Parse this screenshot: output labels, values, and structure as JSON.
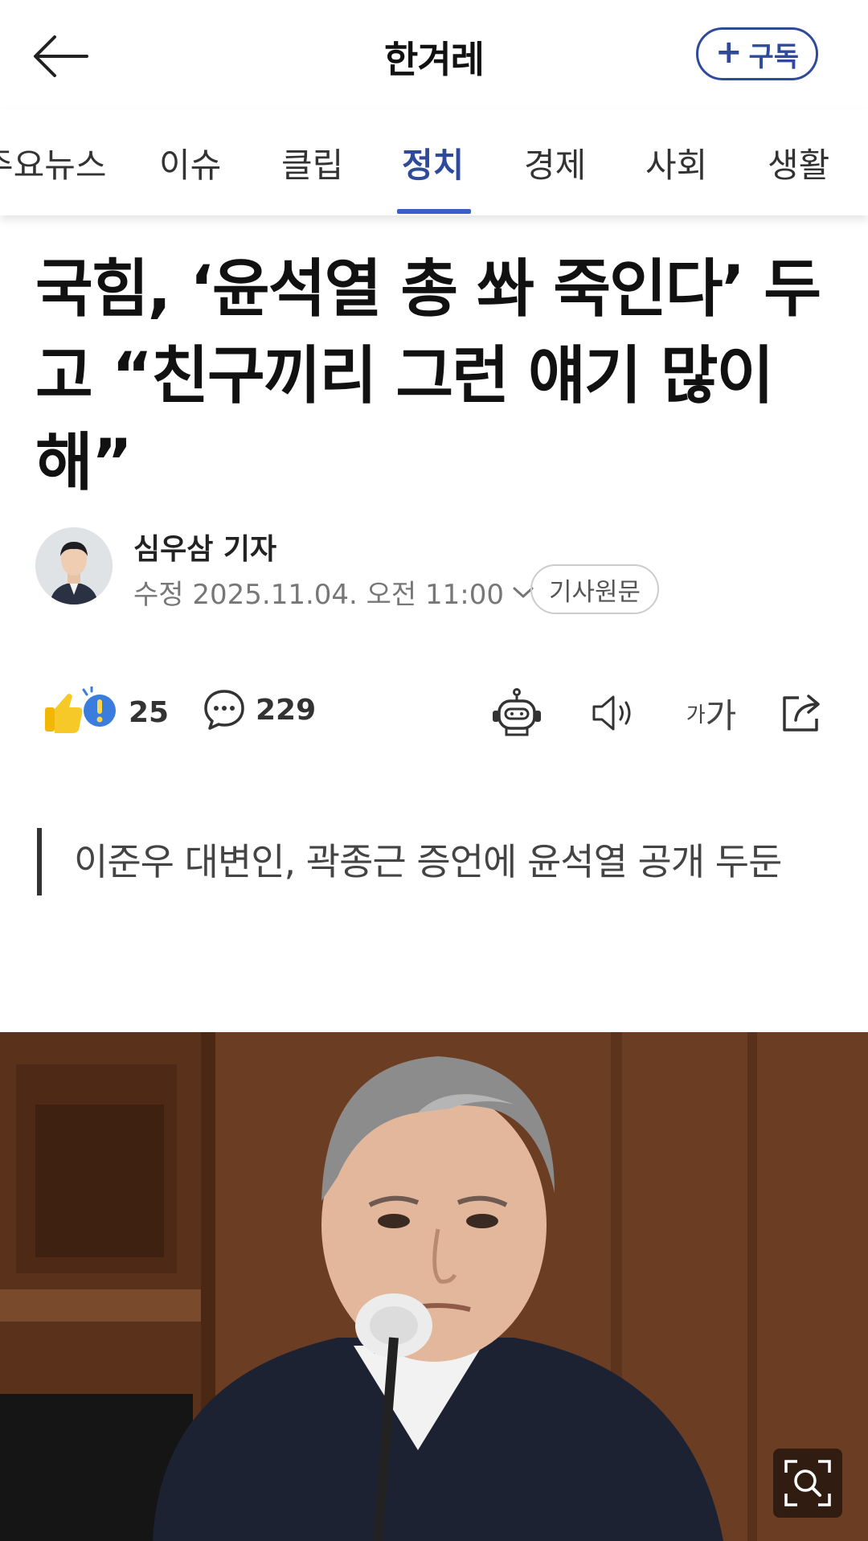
{
  "header": {
    "title": "한겨레",
    "subscribe_label": "구독",
    "subscribe_prefix": "+"
  },
  "tabs": [
    {
      "label": "주요뉴스",
      "active": false
    },
    {
      "label": "이슈",
      "active": false
    },
    {
      "label": "클립",
      "active": false
    },
    {
      "label": "정치",
      "active": true
    },
    {
      "label": "경제",
      "active": false
    },
    {
      "label": "사회",
      "active": false
    },
    {
      "label": "생활",
      "active": false
    }
  ],
  "article": {
    "headline": "국힘, ‘윤석열 총 쏴 죽인다’ 두고 “친구끼리 그런 얘기 많이 해”",
    "reporter": "심우삼 기자",
    "updated": "수정 2025.11.04. 오전 11:00",
    "original_label": "기사원문",
    "subheading": "이준우 대변인, 곽종근 증언에 윤석열 공개 두둔"
  },
  "actions": {
    "reaction_count": "25",
    "comment_count": "229",
    "font_small": "가",
    "font_big": "가"
  },
  "icons": {
    "back": "arrow-left-icon",
    "chevron": "chevron-down-icon",
    "reaction": "reaction-emoji-icon",
    "comment": "comment-bubble-icon",
    "summary": "robot-icon",
    "tts": "speaker-icon",
    "share": "share-icon",
    "zoom": "zoom-search-icon"
  },
  "colors": {
    "accent": "#2f4a9b",
    "tab_underline": "#3b5fc7",
    "text": "#111111",
    "meta": "#777777"
  }
}
